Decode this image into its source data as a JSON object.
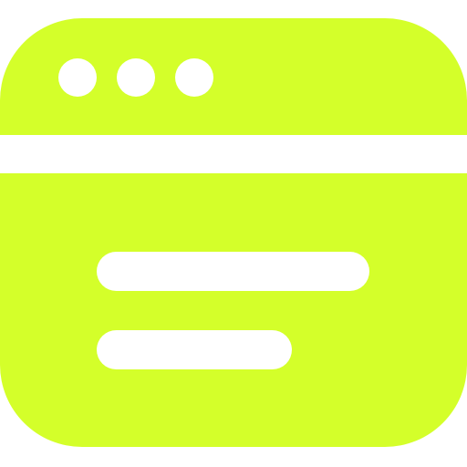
{
  "icon": {
    "name": "browser-window-icon",
    "colors": {
      "fill": "#D4FF2A",
      "cutout": "#FFFFFF",
      "background": "#FFFFFF"
    },
    "window_dots": 3,
    "content_lines": 2
  }
}
